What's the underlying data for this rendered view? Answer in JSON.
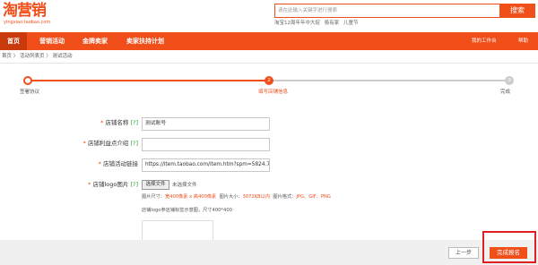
{
  "header": {
    "logo_text": "淘营销",
    "logo_sub": "yingxiao.taobao.com",
    "search_placeholder": "请在此输入关键字进行搜索",
    "search_button": "搜索",
    "hot_words": [
      "淘宝12周年年中大促",
      "极有家",
      "儿童节"
    ]
  },
  "nav": {
    "items": [
      "首页",
      "营销活动",
      "金牌卖家",
      "卖家扶持计划"
    ],
    "right_items": [
      "我的工作台",
      "帮助"
    ],
    "active": "首页"
  },
  "breadcrumb": "首页 〉 活动列表页 〉 测试活动",
  "steps": [
    {
      "num": "1",
      "label": "签署协议",
      "state": "done"
    },
    {
      "num": "2",
      "label": "填写店铺信息",
      "state": "active"
    },
    {
      "num": "3",
      "label": "完成",
      "state": "todo"
    }
  ],
  "form": {
    "shop_name": {
      "label": "店铺名称",
      "help": "[?]",
      "value": "测试账号"
    },
    "shop_intro": {
      "label": "店铺利益点介绍",
      "help": "[?]",
      "value": ""
    },
    "shop_link": {
      "label": "店铺活动链接",
      "value": "https://item.taobao.com/item.htm?spm=5824.7t"
    },
    "shop_logo": {
      "label": "店铺logo图片",
      "help": "[?]",
      "upload_button": "选择文件",
      "upload_status": "未选择文件"
    },
    "image_size_label": "图片尺寸：",
    "image_size_value": "宽400像素 x 高400像素",
    "file_size_label": "图片大小：",
    "file_size_value": "3072KB以内",
    "format_label": "图片格式：",
    "format_value": "JPG、GIF、PNG",
    "preview_note": "店铺logo参店铺标签示意图，尺寸400*400"
  },
  "footer": {
    "prev_button": "上一步",
    "done_button": "完成报名"
  },
  "colors": {
    "brand": "#f04f1a",
    "highlight_frame": "#e02020"
  }
}
